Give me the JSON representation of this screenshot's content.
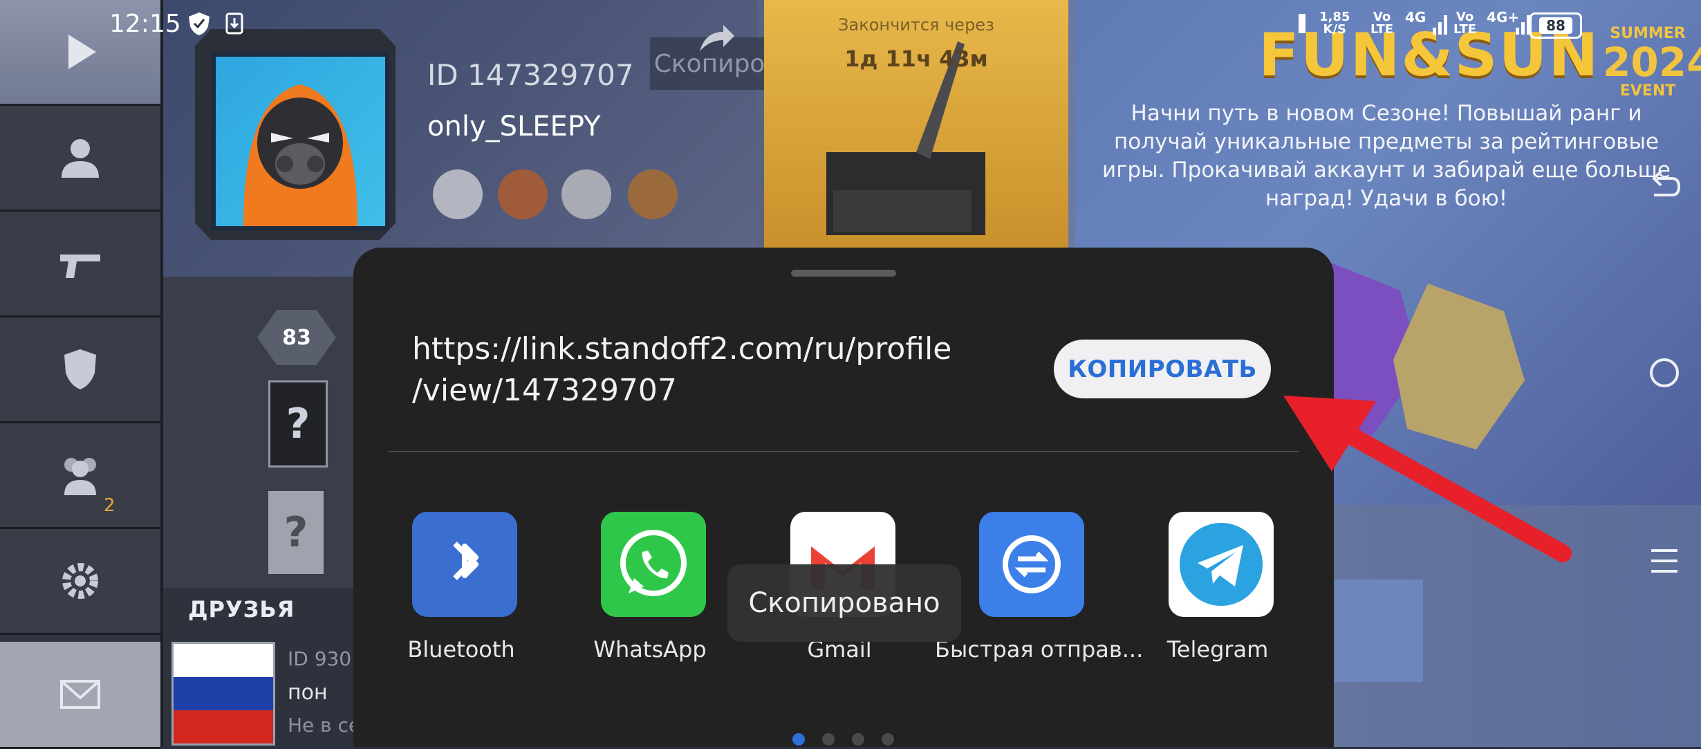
{
  "status_bar": {
    "time": "12:15",
    "speed_value": "1,85",
    "speed_unit": "K/S",
    "sim1_label": "Vo",
    "sim1_sub": "LTE",
    "sim1_net": "4G",
    "sim2_label": "Vo",
    "sim2_sub": "LTE",
    "sim2_net": "4G+",
    "battery": "88"
  },
  "game": {
    "player_id": "ID 147329707",
    "nickname": "only_SLEEPY",
    "copied_banner": "Скопировано в буфер обмена",
    "timer_label": "Закончится через",
    "timer_value": "1д 11ч 43м",
    "event_logo": "FUN&SUN",
    "summer_label": "SUMMER",
    "summer_year": "2024",
    "summer_event": "EVENT",
    "event_description": "Начни путь в новом Сезоне! Повышай ранг и получай уникальные предметы за рейтинговые игры. Прокачивай аккаунт и забирай еще больше наград! Удачи в бою!",
    "level": "83",
    "rank_unknown_1": "?",
    "rank_unknown_2": "?",
    "friends_count": "2",
    "friends_title": "ДРУЗЬЯ",
    "friend_id": "ID 930",
    "friend_name": "пон",
    "friend_status": "Не в се"
  },
  "share_sheet": {
    "url_line1": "https://link.standoff2.com/ru/profile",
    "url_line2": "/view/147329707",
    "copy_label": "КОПИРОВАТЬ",
    "toast": "Скопировано",
    "apps": [
      {
        "label": "Bluetooth",
        "icon": "bluetooth-icon",
        "color": "#3a6fd1"
      },
      {
        "label": "WhatsApp",
        "icon": "whatsapp-icon",
        "color": "#2fc74a"
      },
      {
        "label": "Gmail",
        "icon": "gmail-icon",
        "color": "#ffffff"
      },
      {
        "label": "Быстрая отправ...",
        "icon": "quick-send-icon",
        "color": "#3c7fe8"
      },
      {
        "label": "Telegram",
        "icon": "telegram-icon",
        "color": "#ffffff"
      }
    ],
    "page_count": 4,
    "active_page": 1
  },
  "colors": {
    "annotation_arrow": "#e8202a",
    "sheet_background": "#222222",
    "copy_text": "#2a6fd6"
  }
}
